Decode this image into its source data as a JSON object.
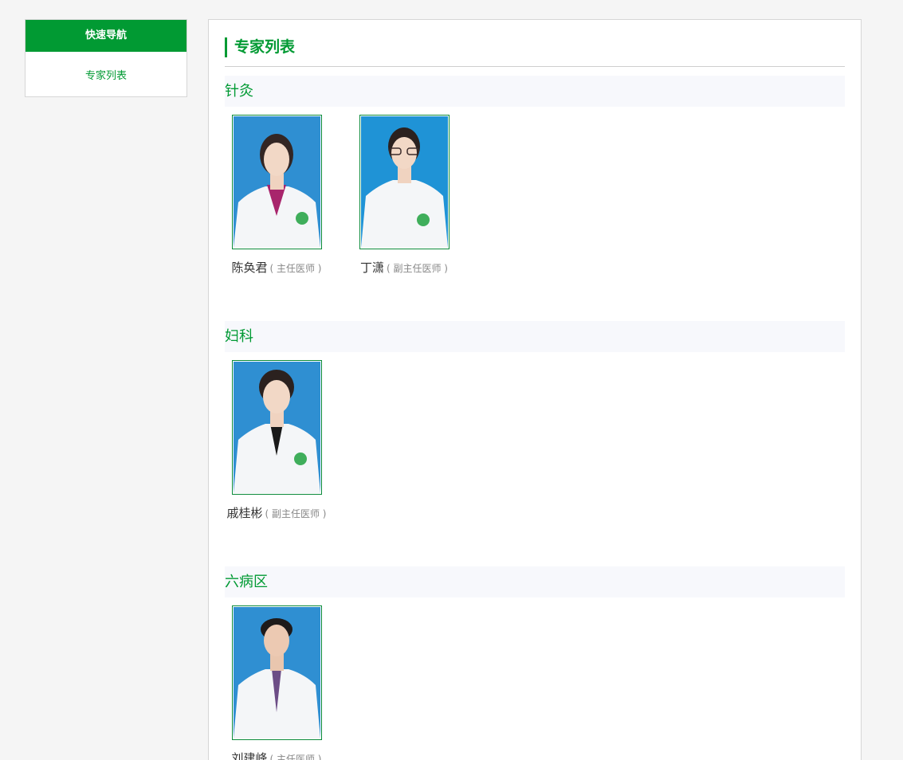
{
  "sidebar": {
    "title": "快速导航",
    "link": "专家列表"
  },
  "main": {
    "title": "专家列表",
    "sections": [
      {
        "name": "针灸",
        "doctors": [
          {
            "name": "陈奂君",
            "title": "( 主任医师 )"
          },
          {
            "name": "丁潇",
            "title": "( 副主任医师 )"
          }
        ]
      },
      {
        "name": "妇科",
        "doctors": [
          {
            "name": "戚桂彬",
            "title": "( 副主任医师 )"
          }
        ]
      },
      {
        "name": "六病区",
        "doctors": [
          {
            "name": "刘建峰",
            "title": "( 主任医师 )"
          }
        ]
      }
    ]
  },
  "colors": {
    "accent": "#019a33",
    "photo_bg": "#2f8fd2",
    "section_bg": "#f7f8fc"
  }
}
